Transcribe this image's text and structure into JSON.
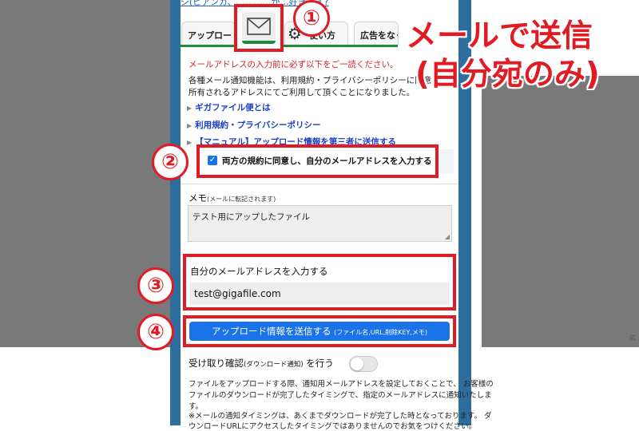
{
  "header_link": "ジ(ビアンカ、…………が…好きです?",
  "tabs": [
    {
      "label": "アップロード"
    },
    {
      "label": "使い方"
    },
    {
      "label": "広告をなくす"
    }
  ],
  "notice": {
    "warning": "メールアドレスの入力前に必ず以下をご一読ください。",
    "line1": "各種メール通知機能は、利用規約・プライバシーポリシーに同意し",
    "line2": "所有されるアドレスにてご利用して頂くことになりました。"
  },
  "links": [
    "ギガファイル便とは",
    "利用規約・プライバシーポリシー",
    "【マニュアル】アップロード情報を第三者に送信する"
  ],
  "agree_checkbox": {
    "label": "両方の規約に同意し、自分のメールアドレスを入力する",
    "checked": true
  },
  "memo": {
    "title": "メモ",
    "note": "(メールに転記されます)",
    "value": "テスト用にアップしたファイル"
  },
  "email": {
    "label": "自分のメールアドレスを入力する",
    "value": "test@gigafile.com"
  },
  "send_button": {
    "label": "アップロード情報を送信する",
    "note": "(ファイル名,URL,削除KEY,メモ)"
  },
  "receipt": {
    "label": "受け取り確認",
    "note": "(ダウンロード通知)",
    "suffix": "を行う",
    "enabled": false
  },
  "fine_print": [
    "ファイルをアップロードする際、通知用メールアドレスを設定しておくことで、 お客様の",
    "ファイルのダウンロードが完了したタイミングで、指定のメールアドレスに通知いたしま",
    "す。",
    "※メールの通知タイミングは、あくまでダウンロードが完了した時となっております。 ダ",
    "ウンロードURLにアクセスしたタイミングではありませんのでお気をつけください。"
  ],
  "annotations": {
    "headline1": "メールで送信",
    "headline2": "(自分宛のみ)",
    "steps": [
      "①",
      "②",
      "③",
      "④"
    ],
    "side_mark": "広"
  },
  "colors": {
    "accent_red": "#e01b24",
    "button_blue": "#1a73e8",
    "link_blue": "#1a3fc4",
    "tab_green": "#1e8a3a",
    "frame_blue": "#2e6e9e"
  },
  "icons": {
    "mail_tab": "envelope-icon",
    "settings_tab": "gear-icon"
  }
}
